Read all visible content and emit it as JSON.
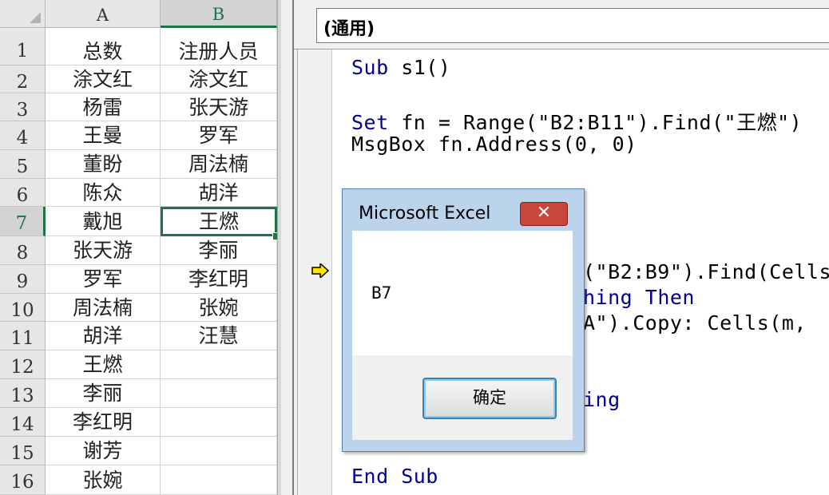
{
  "sheet": {
    "columns": [
      "A",
      "B"
    ],
    "rows": [
      {
        "n": "1",
        "a": "总数",
        "b": "注册人员"
      },
      {
        "n": "2",
        "a": "涂文红",
        "b": "涂文红"
      },
      {
        "n": "3",
        "a": "杨雷",
        "b": "张天游"
      },
      {
        "n": "4",
        "a": "王曼",
        "b": "罗军"
      },
      {
        "n": "5",
        "a": "董盼",
        "b": "周法楠"
      },
      {
        "n": "6",
        "a": "陈众",
        "b": "胡洋"
      },
      {
        "n": "7",
        "a": "戴旭",
        "b": "王燃"
      },
      {
        "n": "8",
        "a": "张天游",
        "b": "李丽"
      },
      {
        "n": "9",
        "a": "罗军",
        "b": "李红明"
      },
      {
        "n": "10",
        "a": "周法楠",
        "b": "张婉"
      },
      {
        "n": "11",
        "a": "胡洋",
        "b": "汪慧"
      },
      {
        "n": "12",
        "a": "王燃",
        "b": ""
      },
      {
        "n": "13",
        "a": "李丽",
        "b": ""
      },
      {
        "n": "14",
        "a": "李红明",
        "b": ""
      },
      {
        "n": "15",
        "a": "谢芳",
        "b": ""
      },
      {
        "n": "16",
        "a": "张婉",
        "b": ""
      }
    ],
    "active_cell": "B7"
  },
  "vbe": {
    "procedure": "(通用)",
    "line1_kw": "Sub",
    "line1_rest": " s1()",
    "line2_kw": "Set",
    "line2_rest": " fn = Range(\"B2:B11\").Find(\"王燃\")",
    "line3": "MsgBox fn.Address(0, 0)",
    "line4": "(\"B2:B9\").Find(Cells",
    "line5_pre": "hing ",
    "line5_kw": "Then",
    "line6": "A\").Copy: Cells(m, ",
    "line7": "ing",
    "line8": "End Sub",
    "execution_arrow_icon": "current-line-arrow"
  },
  "msgbox": {
    "title": "Microsoft Excel",
    "close_glyph": "✕",
    "message": "B7",
    "ok_label": "确定"
  }
}
